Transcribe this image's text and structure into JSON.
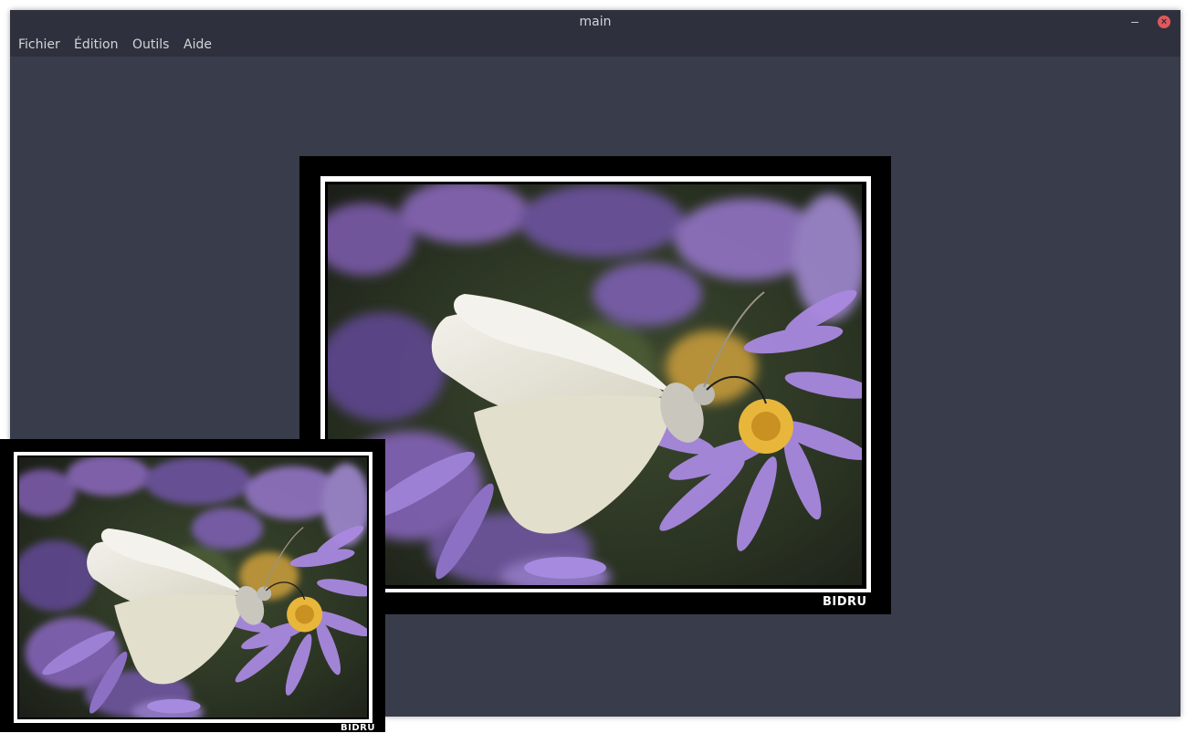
{
  "window": {
    "title": "main",
    "minimize_glyph": "–",
    "close_glyph": "×"
  },
  "menu": {
    "items": [
      {
        "label": "Fichier"
      },
      {
        "label": "Édition"
      },
      {
        "label": "Outils"
      },
      {
        "label": "Aide"
      }
    ]
  },
  "images": {
    "large": {
      "subject": "white butterfly on purple aster flowers",
      "signature": "BIDRU"
    },
    "small": {
      "subject": "white butterfly on purple aster flowers",
      "signature": "BIDRU"
    }
  },
  "colors": {
    "window_bg": "#393c4b",
    "titlebar_bg": "#2e313d",
    "close_button": "#e0585b",
    "frame": "#000000",
    "frame_border": "#ffffff"
  }
}
